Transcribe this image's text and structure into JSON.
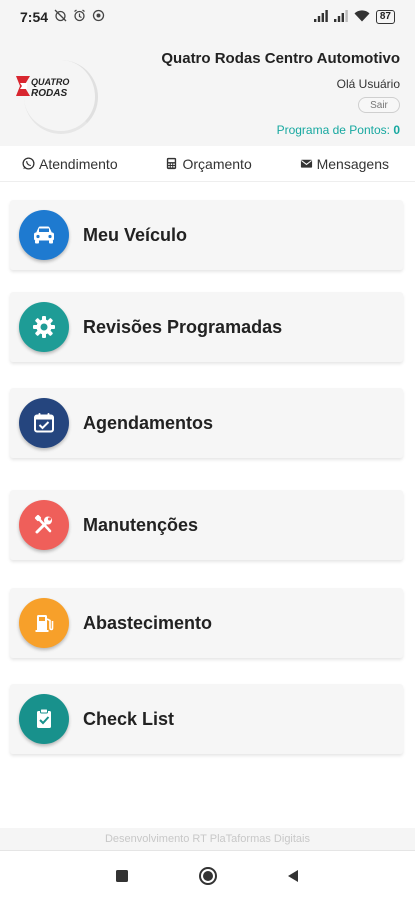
{
  "status_bar": {
    "time": "7:54",
    "battery": "87",
    "left_icons": [
      "mute-alarm-icon",
      "alarm-icon",
      "data-saver-icon"
    ],
    "right_icons": [
      "signal-icon",
      "signal-icon",
      "wifi-icon",
      "battery-icon"
    ]
  },
  "header": {
    "logo_text_line1": "QUATRO",
    "logo_text_line2": "RODAS",
    "company_name": "Quatro Rodas Centro Automotivo",
    "greeting": "Olá Usuário",
    "logout_label": "Sair",
    "points_label": "Programa de Pontos:",
    "points_value": "0"
  },
  "nav": {
    "items": [
      {
        "label": "Atendimento",
        "icon": "whatsapp-icon"
      },
      {
        "label": "Orçamento",
        "icon": "calculator-icon"
      },
      {
        "label": "Mensagens",
        "icon": "envelope-icon"
      }
    ]
  },
  "menu": {
    "items": [
      {
        "label": "Meu Veículo",
        "icon": "car-icon",
        "color": "#1e7ad0"
      },
      {
        "label": "Revisões Programadas",
        "icon": "gear-icon",
        "color": "#1e9c96"
      },
      {
        "label": "Agendamentos",
        "icon": "calendar-check-icon",
        "color": "#25457e"
      },
      {
        "label": "Manutenções",
        "icon": "tools-icon",
        "color": "#ef5f5a"
      },
      {
        "label": "Abastecimento",
        "icon": "fuel-pump-icon",
        "color": "#f7a02a"
      },
      {
        "label": "Check List",
        "icon": "clipboard-check-icon",
        "color": "#18918c"
      }
    ]
  },
  "footer": {
    "text": "Desenvolvimento RT PlaTaformas Digitais"
  },
  "colors": {
    "accent": "#17a8a0",
    "logo_red": "#d8262f"
  }
}
